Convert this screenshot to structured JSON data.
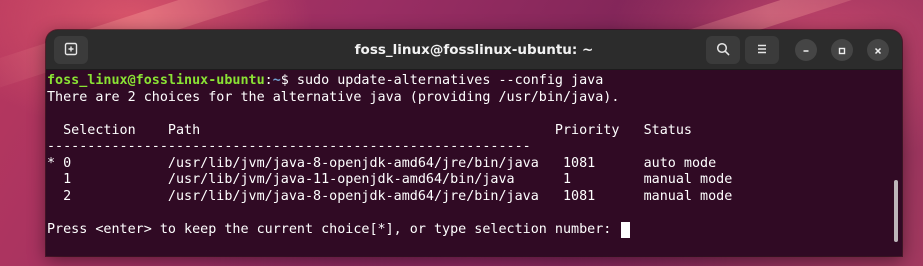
{
  "window": {
    "title": "foss_linux@fosslinux-ubuntu: ~"
  },
  "icons": {
    "new_tab": "new-tab-icon",
    "search": "search-icon",
    "menu": "hamburger-menu-icon",
    "minimize": "minimize-icon",
    "maximize": "maximize-icon",
    "close": "close-icon"
  },
  "terminal": {
    "prompt": {
      "user_host": "foss_linux@fosslinux-ubuntu",
      "separator": ":",
      "path": "~",
      "symbol": "$ "
    },
    "command": "sudo update-alternatives --config java",
    "info_line": "There are 2 choices for the alternative java (providing /usr/bin/java).",
    "blank": "",
    "header_line": "  Selection    Path                                            Priority   Status",
    "divider_line": "------------------------------------------------------------",
    "rows": [
      "* 0            /usr/lib/jvm/java-8-openjdk-amd64/jre/bin/java   1081      auto mode",
      "  1            /usr/lib/jvm/java-11-openjdk-amd64/bin/java      1         manual mode",
      "  2            /usr/lib/jvm/java-8-openjdk-amd64/jre/bin/java   1081      manual mode"
    ],
    "input_prompt": "Press <enter> to keep the current choice[*], or type selection number: "
  },
  "colors": {
    "terminal_bg": "#300a24",
    "titlebar_bg": "#2c2c2c",
    "prompt_user": "#8ae234",
    "prompt_path": "#729fcf"
  }
}
